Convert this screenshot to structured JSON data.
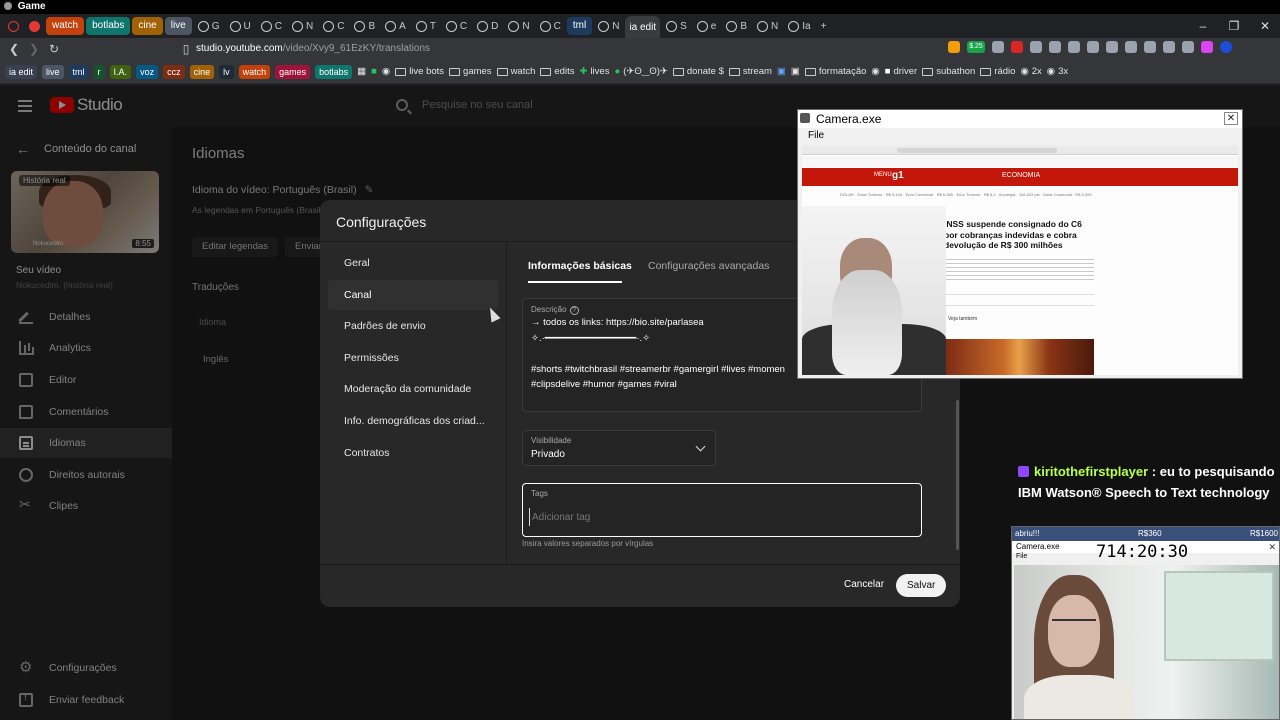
{
  "window": {
    "title": "Game"
  },
  "tabs": {
    "pills": [
      {
        "label": "watch",
        "color": "#c2410c"
      },
      {
        "label": "botlabs",
        "color": "#0f766e"
      },
      {
        "label": "cine",
        "color": "#a16207"
      },
      {
        "label": "live",
        "color": "#4b5563"
      }
    ],
    "mini": [
      "G",
      "U",
      "C",
      "N",
      "C",
      "B",
      "A",
      "T",
      "C",
      "D",
      "N",
      "C",
      "N"
    ],
    "tml": {
      "label": "tml",
      "color": "#1e3a5f"
    },
    "mini2": [
      "N"
    ],
    "active": "ia edit",
    "mini3": [
      "S",
      "e",
      "B",
      "N",
      "Ia",
      "S",
      "E",
      "N"
    ]
  },
  "address": {
    "host": "studio.youtube.com",
    "path": "/video/Xvy9_61EzKY/translations",
    "badge": "$.25"
  },
  "bookmarks": {
    "tags": [
      {
        "label": "ia edit",
        "color": "#374151"
      },
      {
        "label": "live",
        "color": "#4b5563"
      },
      {
        "label": "tml",
        "color": "#1e3a5f"
      },
      {
        "label": "r",
        "color": "#14532d"
      },
      {
        "label": "I.A.",
        "color": "#3f6212"
      },
      {
        "label": "voz",
        "color": "#075985"
      },
      {
        "label": "ccz",
        "color": "#7c2d12"
      },
      {
        "label": "cine",
        "color": "#a16207"
      },
      {
        "label": "lv",
        "color": "#1f2937"
      },
      {
        "label": "watch",
        "color": "#c2410c"
      },
      {
        "label": "games",
        "color": "#9f1239"
      },
      {
        "label": "botlabs",
        "color": "#0f766e"
      }
    ],
    "items": [
      "live bots",
      "games",
      "watch",
      "edits",
      "lives",
      "(✈ʘ‿ʘ)✈",
      "donate $",
      "stream",
      "formatação",
      "driver",
      "subathon",
      "rádio",
      "2x",
      "3x"
    ]
  },
  "studio": {
    "logo_text": "Studio",
    "search_placeholder": "Pesquise no seu canal"
  },
  "sidebar": {
    "back_label": "Conteúdo do canal",
    "thumb_badge": "História real",
    "thumb_watermark": "Nokucedim",
    "thumb_duration": "8:55",
    "your_video": "Seu vídeo",
    "video_subtitle": "Nokucedim. (história real)",
    "items": [
      {
        "label": "Detalhes",
        "icon": "pencil-icon"
      },
      {
        "label": "Analytics",
        "icon": "analytics-icon"
      },
      {
        "label": "Editor",
        "icon": "editor-icon"
      },
      {
        "label": "Comentários",
        "icon": "comments-icon"
      },
      {
        "label": "Idiomas",
        "icon": "languages-icon",
        "active": true
      },
      {
        "label": "Direitos autorais",
        "icon": "copyright-icon"
      },
      {
        "label": "Clipes",
        "icon": "clips-icon"
      }
    ],
    "bottom_items": [
      {
        "label": "Configurações",
        "icon": "gear-icon"
      },
      {
        "label": "Enviar feedback",
        "icon": "feedback-icon"
      }
    ]
  },
  "main": {
    "page_title": "Idiomas",
    "video_language": "Idioma do vídeo: Português (Brasil)",
    "subtitles_line": "As legendas em Português (Brasil)",
    "edit_subtitles": "Editar legendas",
    "send_label": "Enviar",
    "translations_header": "Traduções",
    "translations_sub": "Idioma",
    "translations_row": "Inglês"
  },
  "modal": {
    "title": "Configurações",
    "nav": [
      "Geral",
      "Canal",
      "Padrões de envio",
      "Permissões",
      "Moderação da comunidade",
      "Info. demográficas dos criad...",
      "Contratos"
    ],
    "active_nav": "Canal",
    "subtabs": [
      "Informações básicas",
      "Configurações avançadas"
    ],
    "description": {
      "label": "Descrição",
      "text": "→ todos os links: https://bio.site/parlasea\n✧.·━━━━━━━━━━━━━━━━·.✧\n\n#shorts #twitchbrasil #streamerbr #gamergirl #lives #momen\n#clipsdelive #humor #games #viral"
    },
    "visibility": {
      "label": "Visibilidade",
      "value": "Privado"
    },
    "tags": {
      "label": "Tags",
      "placeholder": "Adicionar tag",
      "hint": "Insira valores separados por vírgulas"
    },
    "cancel_label": "Cancelar",
    "save_label": "Salvar"
  },
  "camera": {
    "title": "Camera.exe",
    "menu_file": "File",
    "site": {
      "menu": "MENU",
      "logo": "g1",
      "section": "ECONOMIA",
      "ticker": "DÓLAR · Dólar Turismo · R$ 5,444 · Euro Comercial · R$ 6,380 · Euro Turismo · R$ 6,2 · Ibovespa · 118.623 pts · Dólar Comercial · R$ 5,393",
      "headline": "INSS suspende consignado do C6 por cobranças indevidas e cobra devolução de R$ 300 milhões",
      "veja": "Veja também"
    }
  },
  "chat": {
    "user": "kiritothefirstplayer",
    "message": " : eu to pesquisando IBM Watson® Speech to Text technology"
  },
  "small_cam": {
    "left": "abriu!!!",
    "middle": "R$360",
    "right": "R$1600",
    "title": "Camera.exe",
    "time": "714:20:30",
    "menu": "File"
  }
}
